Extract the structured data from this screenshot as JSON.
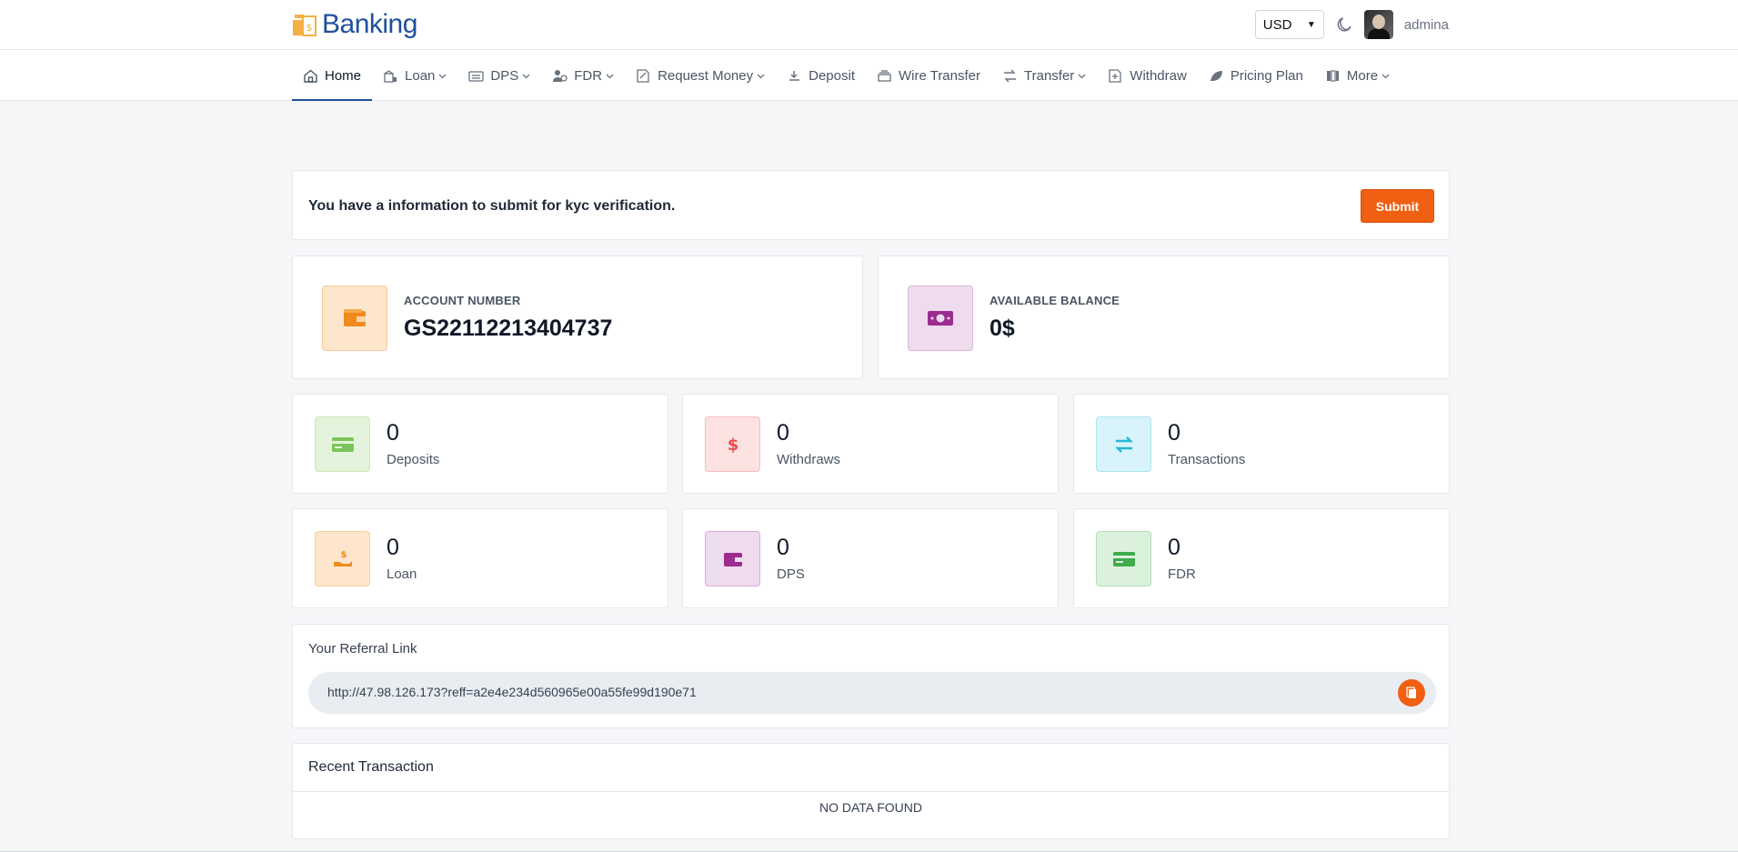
{
  "brand": {
    "name": "Banking"
  },
  "header": {
    "currency": "USD",
    "username": "admina"
  },
  "nav": [
    {
      "label": "Home",
      "icon": "home-icon",
      "dropdown": false
    },
    {
      "label": "Loan",
      "icon": "bank-icon",
      "dropdown": true
    },
    {
      "label": "DPS",
      "icon": "vault-icon",
      "dropdown": true
    },
    {
      "label": "FDR",
      "icon": "user-coin-icon",
      "dropdown": true
    },
    {
      "label": "Request Money",
      "icon": "request-icon",
      "dropdown": true
    },
    {
      "label": "Deposit",
      "icon": "deposit-icon",
      "dropdown": false
    },
    {
      "label": "Wire Transfer",
      "icon": "wire-icon",
      "dropdown": false
    },
    {
      "label": "Transfer",
      "icon": "arrows-icon",
      "dropdown": true
    },
    {
      "label": "Withdraw",
      "icon": "withdraw-icon",
      "dropdown": false
    },
    {
      "label": "Pricing Plan",
      "icon": "leaf-icon",
      "dropdown": false
    },
    {
      "label": "More",
      "icon": "grid-icon",
      "dropdown": true
    }
  ],
  "kyc": {
    "message": "You have a information to submit for kyc verification.",
    "button": "Submit"
  },
  "account": {
    "label": "ACCOUNT NUMBER",
    "value": "GS22112213404737"
  },
  "balance": {
    "label": "AVAILABLE BALANCE",
    "value": "0$"
  },
  "stats": [
    {
      "value": "0",
      "label": "Deposits",
      "icon": "card-icon",
      "bg": "#e4f4dc",
      "fg": "#7cc45a"
    },
    {
      "value": "0",
      "label": "Withdraws",
      "icon": "dollar-icon",
      "bg": "#fde2e2",
      "fg": "#ea4b4b"
    },
    {
      "value": "0",
      "label": "Transactions",
      "icon": "exchange-icon",
      "bg": "#d8f4fa",
      "fg": "#25b6d6"
    },
    {
      "value": "0",
      "label": "Loan",
      "icon": "hand-coin-icon",
      "bg": "#fde6cc",
      "fg": "#f08a1c"
    },
    {
      "value": "0",
      "label": "DPS",
      "icon": "wallet-icon",
      "bg": "#eedbee",
      "fg": "#9b2c8d"
    },
    {
      "value": "0",
      "label": "FDR",
      "icon": "credit-card-icon",
      "bg": "#dcf1dc",
      "fg": "#3fab4a"
    }
  ],
  "referral": {
    "title": "Your Referral Link",
    "link": "http://47.98.126.173?reff=a2e4e234d560965e00a55fe99d190e71"
  },
  "recent": {
    "title": "Recent Transaction",
    "empty": "NO DATA FOUND"
  },
  "colors": {
    "accent": "#f05f12",
    "brand": "#1f4f9c",
    "account_bg": "#fde6cc",
    "balance_bg": "#eedbee"
  }
}
